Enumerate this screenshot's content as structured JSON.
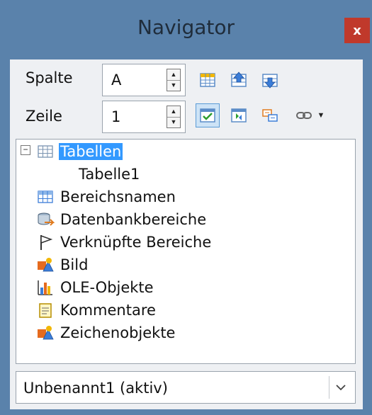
{
  "window": {
    "title": "Navigator",
    "close_label": "x"
  },
  "navigator": {
    "column_label": "Spalte",
    "column_value": "A",
    "row_label": "Zeile",
    "row_value": "1"
  },
  "tree": {
    "items": [
      {
        "label": "Tabellen",
        "icon": "table-icon",
        "expanded": true,
        "selected": true
      },
      {
        "label": "Tabelle1",
        "icon": "",
        "child": true
      },
      {
        "label": "Bereichsnamen",
        "icon": "range-names-icon"
      },
      {
        "label": "Datenbankbereiche",
        "icon": "database-range-icon"
      },
      {
        "label": "Verknüpfte Bereiche",
        "icon": "linked-area-flag-icon"
      },
      {
        "label": "Bild",
        "icon": "image-icon"
      },
      {
        "label": "OLE-Objekte",
        "icon": "ole-chart-icon"
      },
      {
        "label": "Kommentare",
        "icon": "comment-icon"
      },
      {
        "label": "Zeichenobjekte",
        "icon": "drawing-objects-icon"
      }
    ]
  },
  "document": {
    "selected": "Unbenannt1 (aktiv)"
  },
  "colors": {
    "titlebar": "#5a82ab",
    "close": "#c0392b",
    "selection": "#3399ff",
    "panel": "#eef0f3"
  }
}
